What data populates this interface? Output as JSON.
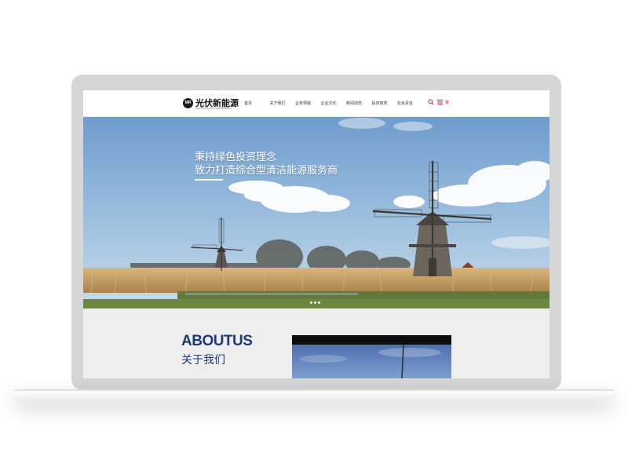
{
  "header": {
    "logo_mark": "MR",
    "logo_title": "光伏新能源",
    "logo_subtitle": "PHOTOVOLTAIC NEW ENERGY",
    "nav_items": [
      "首页",
      "关于我们",
      "业务领域",
      "企业文化",
      "新闻动态",
      "投资商务",
      "社会责任"
    ],
    "lang": "繁"
  },
  "hero": {
    "line1": "秉持绿色投资理念",
    "line2": "致力打造综合型清洁能源服务商",
    "slides": 3,
    "active_slide": 1
  },
  "about": {
    "title_en": "ABOUTUS",
    "title_cn": "关于我们"
  },
  "colors": {
    "accent": "#c0282d",
    "about_title": "#1f3a7a",
    "laptop_frame": "#d6d6d6"
  }
}
